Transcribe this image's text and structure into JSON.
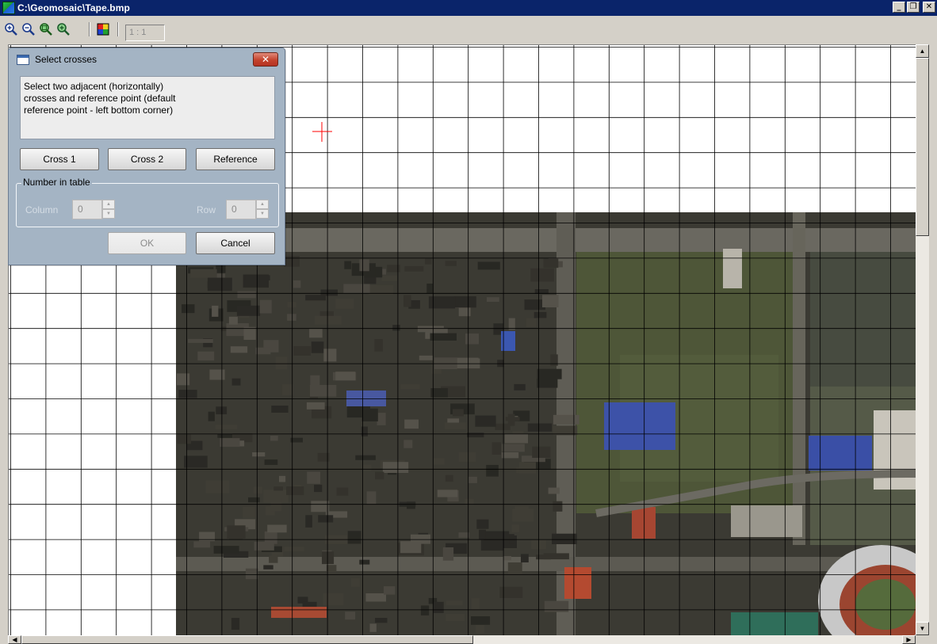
{
  "window": {
    "title": "C:\\Geomosaic\\Tape.bmp",
    "minimize_glyph": "_",
    "restore_glyph": "❐",
    "close_glyph": "✕"
  },
  "toolbar": {
    "icons": [
      "zoom-in-icon",
      "zoom-out-icon",
      "zoom-fit-icon",
      "zoom-actual-icon",
      "color-palette-icon"
    ],
    "zoom_level": "1 : 1"
  },
  "dialog": {
    "title": "Select crosses",
    "close_glyph": "✕",
    "instructions": "Select two adjacent (horizontally)\ncrosses and reference point (default\nreference point - left bottom corner)",
    "buttons": {
      "cross1": "Cross 1",
      "cross2": "Cross 2",
      "reference": "Reference",
      "ok": "OK",
      "cancel": "Cancel"
    },
    "group": {
      "label": "Number in table",
      "column_label": "Column",
      "column_value": "0",
      "row_label": "Row",
      "row_value": "0"
    }
  },
  "scrollbars": {
    "up_glyph": "▲",
    "down_glyph": "▼",
    "left_glyph": "◀",
    "right_glyph": "▶"
  },
  "colors": {
    "titlebar": "#0a246a",
    "grid_line": "#000000",
    "cross_marker": "#ff0000",
    "dialog_bg": "#a4b4c4"
  }
}
